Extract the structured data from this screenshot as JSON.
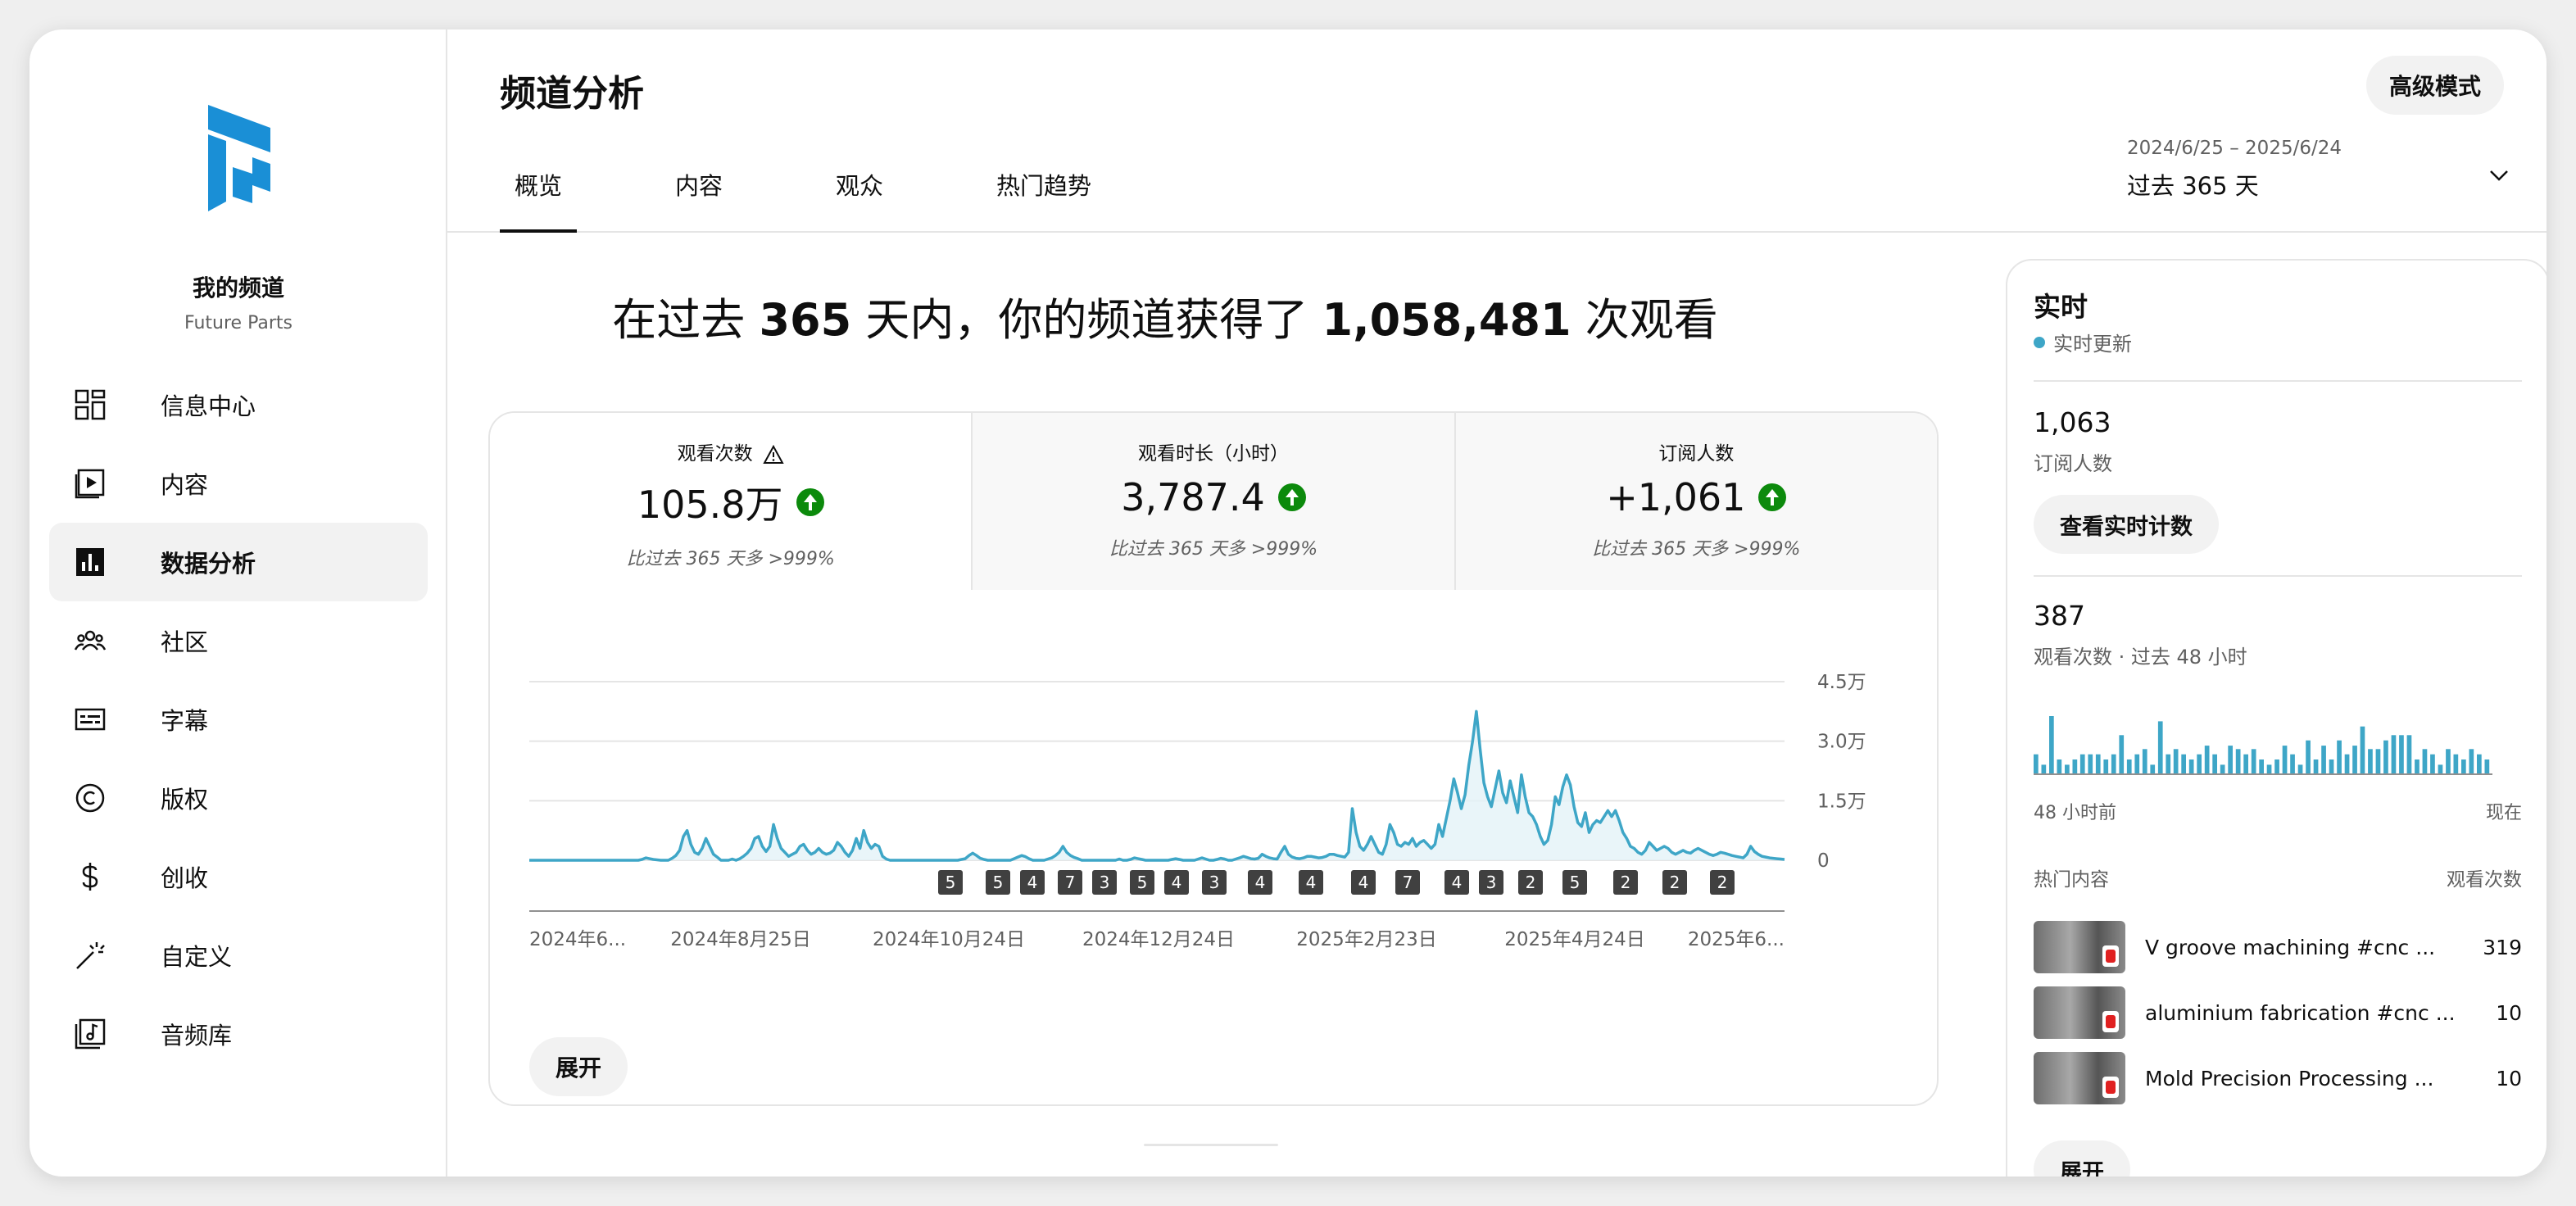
{
  "sidebar": {
    "channel_name": "我的频道",
    "channel_sub": "Future Parts",
    "items": [
      {
        "label": "信息中心",
        "icon": "dashboard-icon"
      },
      {
        "label": "内容",
        "icon": "content-icon"
      },
      {
        "label": "数据分析",
        "icon": "analytics-icon",
        "active": true
      },
      {
        "label": "社区",
        "icon": "community-icon"
      },
      {
        "label": "字幕",
        "icon": "subtitles-icon"
      },
      {
        "label": "版权",
        "icon": "copyright-icon"
      },
      {
        "label": "创收",
        "icon": "earn-icon"
      },
      {
        "label": "自定义",
        "icon": "customization-icon"
      },
      {
        "label": "音频库",
        "icon": "audio-library-icon"
      }
    ]
  },
  "header": {
    "title": "频道分析",
    "advanced_mode": "高级模式",
    "tabs": [
      "概览",
      "内容",
      "观众",
      "热门趋势"
    ],
    "date_range": "2024/6/25 – 2025/6/24",
    "date_label": "过去 365 天"
  },
  "main": {
    "headline_pre": "在过去 ",
    "headline_days": "365",
    "headline_mid": " 天内，你的频道获得了 ",
    "headline_views": "1,058,481",
    "headline_post": " 次观看",
    "metrics": [
      {
        "label": "观看次数",
        "value": "105.8万",
        "compare": "比过去 365 天多 >999%"
      },
      {
        "label": "观看时长（小时）",
        "value": "3,787.4",
        "compare": "比过去 365 天多 >999%"
      },
      {
        "label": "订阅人数",
        "value": "+1,061",
        "compare": "比过去 365 天多 >999%"
      }
    ],
    "expand": "展开"
  },
  "chart_data": {
    "type": "area",
    "x_labels": [
      "2024年6...",
      "2024年8月25日",
      "2024年10月24日",
      "2024年12月24日",
      "2025年2月23日",
      "2025年4月24日",
      "2025年6..."
    ],
    "y_ticks": [
      "4.5万",
      "3.0万",
      "1.5万",
      "0"
    ],
    "ylim": [
      0,
      45000
    ],
    "series": [
      {
        "values": [
          0,
          0,
          0,
          0,
          0,
          0,
          0,
          0,
          0,
          0,
          0,
          0,
          0,
          0,
          0,
          0,
          0,
          0,
          0,
          0,
          0,
          0,
          0,
          0,
          0,
          0,
          0,
          0,
          0,
          0,
          200,
          600,
          400,
          200,
          100,
          0,
          0,
          0,
          500,
          1200,
          2500,
          6000,
          7500,
          4000,
          2000,
          1500,
          3000,
          5500,
          3500,
          1500,
          800,
          0,
          0,
          0,
          300,
          0,
          400,
          1000,
          1800,
          3000,
          5500,
          6000,
          3500,
          2200,
          3500,
          9000,
          5500,
          3000,
          2000,
          1000,
          1500,
          2000,
          3500,
          4000,
          2500,
          1500,
          2000,
          3000,
          2000,
          1500,
          1800,
          2500,
          4500,
          3500,
          2000,
          1000,
          2500,
          5500,
          3000,
          7500,
          4500,
          3000,
          4000,
          3500,
          1000,
          300,
          0,
          0,
          0,
          0,
          0,
          0,
          0,
          0,
          0,
          0,
          0,
          0,
          0,
          0,
          0,
          0,
          0,
          0,
          0,
          200,
          400,
          1200,
          1800,
          1200,
          500,
          200,
          0,
          0,
          0,
          0,
          0,
          0,
          0,
          400,
          800,
          1200,
          900,
          400,
          0,
          0,
          0,
          0,
          300,
          600,
          1200,
          2000,
          3500,
          2000,
          1200,
          700,
          400,
          0,
          0,
          0,
          0,
          0,
          0,
          0,
          0,
          0,
          0,
          300,
          0,
          0,
          200,
          600,
          400,
          200,
          0,
          0,
          0,
          0,
          0,
          0,
          0,
          200,
          400,
          200,
          0,
          0,
          0,
          0,
          300,
          600,
          300,
          0,
          0,
          200,
          500,
          300,
          0,
          0,
          300,
          600,
          1000,
          700,
          400,
          300,
          500,
          1500,
          1000,
          600,
          400,
          300,
          2000,
          3500,
          1500,
          800,
          500,
          400,
          600,
          1000,
          1000,
          800,
          600,
          700,
          1000,
          1500,
          1500,
          1200,
          1000,
          800,
          2000,
          13000,
          7000,
          3500,
          2500,
          4000,
          6000,
          4000,
          2000,
          1500,
          4000,
          9000,
          7000,
          4000,
          3500,
          4500,
          4000,
          5500,
          3500,
          4500,
          5000,
          4000,
          3000,
          4000,
          9000,
          6000,
          10500,
          15000,
          20500,
          17000,
          13000,
          16500,
          24000,
          30000,
          37500,
          28000,
          19500,
          16000,
          13500,
          18000,
          22500,
          17000,
          14500,
          20000,
          16000,
          12000,
          21500,
          16000,
          12000,
          11000,
          9000,
          6000,
          4000,
          5000,
          9000,
          16000,
          14000,
          18500,
          21500,
          19000,
          13500,
          9500,
          8500,
          12000,
          7000,
          9000,
          10000,
          9500,
          11000,
          12500,
          11000,
          12500,
          10000,
          7000,
          5500,
          3500,
          3000,
          2000,
          1500,
          2500,
          4500,
          3500,
          2500,
          3000,
          3500,
          3000,
          2000,
          1500,
          2000,
          2500,
          2000,
          1800,
          2500,
          3000,
          2500,
          2000,
          1500,
          1200,
          1500,
          2000,
          1800,
          1500,
          1200,
          1000,
          800,
          600,
          1500,
          3500,
          2200,
          1500,
          1000,
          800,
          600,
          500,
          400,
          300,
          200
        ]
      }
    ],
    "annotations": [
      5,
      5,
      4,
      7,
      3,
      5,
      4,
      3,
      4,
      4,
      4,
      7,
      4,
      3,
      2,
      5,
      2,
      2,
      2
    ],
    "grid": true
  },
  "realtime": {
    "title": "实时",
    "live": "实时更新",
    "subs_value": "1,063",
    "subs_label": "订阅人数",
    "live_count_btn": "查看实时计数",
    "views_value": "387",
    "views_label": "观看次数 · 过去 48 小时",
    "axis_left": "48 小时前",
    "axis_right": "现在",
    "bars": [
      11,
      5,
      33,
      8,
      5,
      8,
      11,
      11,
      11,
      8,
      11,
      22,
      8,
      11,
      14,
      5,
      30,
      11,
      14,
      11,
      8,
      11,
      16,
      11,
      5,
      16,
      14,
      11,
      14,
      8,
      5,
      8,
      16,
      11,
      5,
      19,
      8,
      16,
      8,
      19,
      11,
      16,
      27,
      14,
      14,
      19,
      22,
      22,
      22,
      8,
      14,
      11,
      5,
      14,
      11,
      8,
      14,
      11,
      8
    ],
    "top_header_left": "热门内容",
    "top_header_right": "观看次数",
    "top_items": [
      {
        "title": "V groove machining #cnc ...",
        "views": "319"
      },
      {
        "title": "aluminium fabrication #cnc ...",
        "views": "10"
      },
      {
        "title": "Mold Precision Processing ...",
        "views": "10"
      }
    ],
    "expand": "展开"
  },
  "colors": {
    "accent": "#3ea6c7",
    "up": "#0c8a0c",
    "badge": "#404040"
  }
}
